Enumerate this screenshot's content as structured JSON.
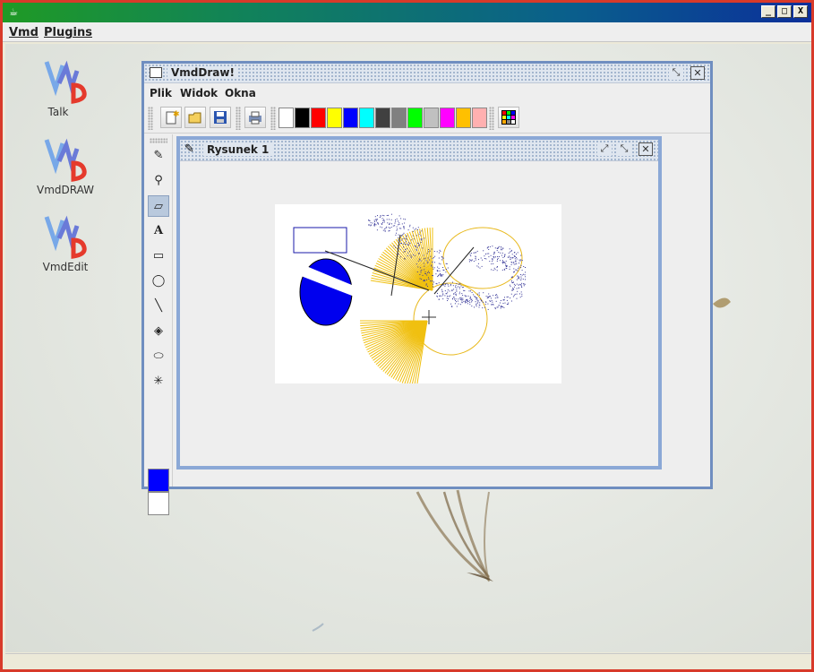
{
  "window": {
    "title": "",
    "buttons": [
      "_",
      "□",
      "X"
    ]
  },
  "menubar": {
    "items": [
      "Vmd",
      "Plugins"
    ]
  },
  "desktop": {
    "icons": [
      {
        "label": "Talk",
        "icon": "vmd-logo-icon"
      },
      {
        "label": "VmdDRAW",
        "icon": "vmd-logo-icon"
      },
      {
        "label": "VmdEdit",
        "icon": "vmd-logo-icon"
      }
    ]
  },
  "vmddraw": {
    "title": "VmdDraw!",
    "menu": [
      "Plik",
      "Widok",
      "Okna"
    ],
    "toolbar": {
      "buttons": [
        "new-file-icon",
        "open-folder-icon",
        "save-disk-icon",
        "print-icon"
      ],
      "palette": [
        "#ffffff",
        "#000000",
        "#ff0000",
        "#ffff00",
        "#0000ff",
        "#00ffff",
        "#404040",
        "#808080",
        "#00ff00",
        "#c0c0c0",
        "#ff00ff",
        "#ffc000",
        "#ffb0b0"
      ],
      "palette_button": "color-grid-icon"
    },
    "tools": [
      "pencil-icon",
      "eyedropper-icon",
      "eraser-icon",
      "text-tool-icon",
      "rectangle-tool-icon",
      "ellipse-tool-icon",
      "line-tool-icon",
      "fill-bucket-icon",
      "spray-icon",
      "star-burst-icon"
    ],
    "tool_glyphs": [
      "✎",
      "⚲",
      "▱",
      "A",
      "▭",
      "◯",
      "╲",
      "◈",
      "⬭",
      "✳"
    ],
    "selected_tool": 2,
    "foreground_color": "#0000ff",
    "background_color": "#ffffff"
  },
  "drawing": {
    "title": "Rysunek 1"
  },
  "colors": {
    "accent_blue": "#0000ee",
    "gold": "#f5c518",
    "spray": "#3a3a9a"
  }
}
